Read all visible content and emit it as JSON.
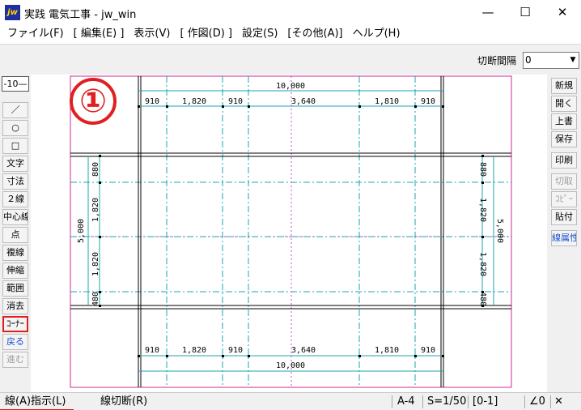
{
  "window": {
    "app_icon": "jw",
    "title": "実践 電気工事 - jw_win",
    "minimize": "—",
    "maximize": "☐",
    "close": "✕"
  },
  "menu": [
    "ファイル(F)",
    "[ 編集(E) ]",
    "表示(V)",
    "[ 作図(D) ]",
    "設定(S)",
    "[その他(A)]",
    "ヘルプ(H)"
  ],
  "control_bar": {
    "label": "切断間隔",
    "value": "0",
    "arrow": "▼"
  },
  "left_toolbar": {
    "layer": "-10—",
    "tools": [
      {
        "label": "／",
        "state": "normal"
      },
      {
        "label": "○",
        "state": "normal"
      },
      {
        "label": "□",
        "state": "normal"
      },
      {
        "label": "文字",
        "state": "normal"
      },
      {
        "label": "寸法",
        "state": "normal"
      },
      {
        "label": "２線",
        "state": "normal"
      },
      {
        "label": "中心線",
        "state": "normal"
      },
      {
        "label": "点",
        "state": "normal"
      },
      {
        "label": "複線",
        "state": "normal"
      },
      {
        "label": "伸縮",
        "state": "normal"
      },
      {
        "label": "範囲",
        "state": "normal"
      },
      {
        "label": "消去",
        "state": "normal"
      },
      {
        "label": "ｺｰﾅｰ",
        "state": "active"
      },
      {
        "label": "戻る",
        "state": "link"
      },
      {
        "label": "進む",
        "state": "disabled"
      }
    ]
  },
  "right_toolbar": [
    {
      "label": "新規",
      "state": "normal"
    },
    {
      "label": "開く",
      "state": "normal"
    },
    {
      "label": "上書",
      "state": "normal"
    },
    {
      "label": "保存",
      "state": "normal"
    },
    {
      "label": "印刷",
      "state": "normal"
    },
    {
      "label": "切取",
      "state": "disabled"
    },
    {
      "label": "ｺﾋﾟｰ",
      "state": "disabled"
    },
    {
      "label": "貼付",
      "state": "normal"
    },
    {
      "label": "線属性",
      "state": "link"
    }
  ],
  "drawing": {
    "badge": "①",
    "top_overall": "10,000",
    "bottom_overall": "10,000",
    "top_dims": [
      "910",
      "1,820",
      "910",
      "3,640",
      "1,810",
      "910"
    ],
    "bottom_dims": [
      "910",
      "1,820",
      "910",
      "3,640",
      "1,810",
      "910"
    ],
    "left_dims": [
      "880",
      "1,820",
      "1,820",
      "480"
    ],
    "right_dims": [
      "880",
      "1,820",
      "1,820",
      "480"
    ],
    "left_overall": "5,000",
    "right_overall": "5,000"
  },
  "status": {
    "left_instruction": "線(A)指示(L)",
    "right_instruction": "線切断(R)",
    "paper": "A-4",
    "scale": "S=1/50",
    "layer_state": "[0-1]",
    "angle": "∠0",
    "close": "✕"
  },
  "colors": {
    "sheet_border": "#cc2c9a",
    "construction_line": "#19a5b0",
    "center_line": "#d04ad0",
    "wall_line": "#000000",
    "highlight": "#e02020"
  }
}
